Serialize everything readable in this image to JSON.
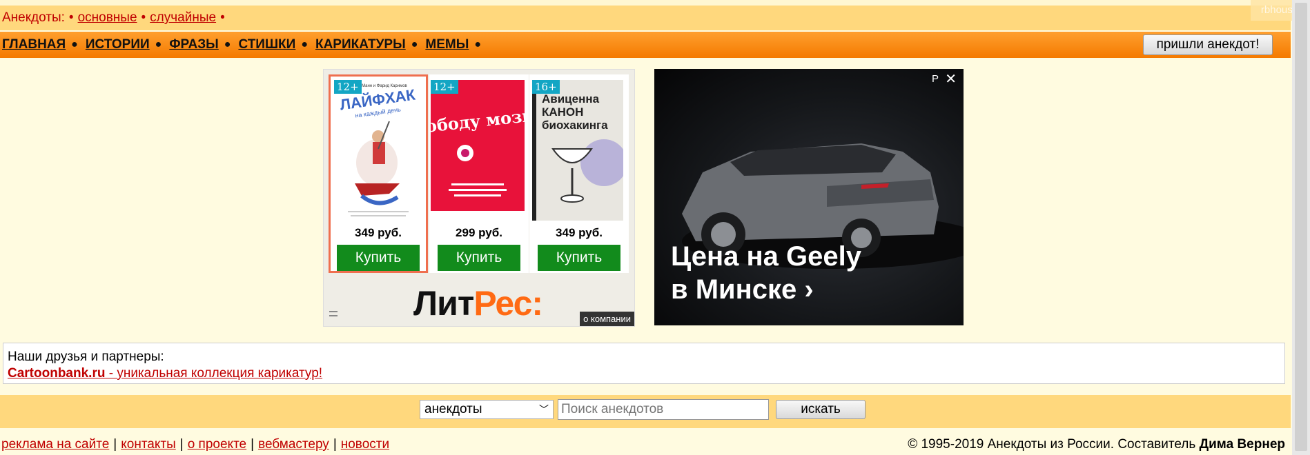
{
  "top_bar": {
    "label": "Анекдоты:",
    "links": [
      "основные",
      "случайные"
    ],
    "corner": "rbhouse"
  },
  "nav": {
    "items": [
      "ГЛАВНАЯ",
      "ИСТОРИИ",
      "ФРАЗЫ",
      "СТИШКИ",
      "КАРИКАТУРЫ",
      "МЕМЫ"
    ],
    "send_button": "пришли анекдот!"
  },
  "litres_ad": {
    "books": [
      {
        "age": "12+",
        "cover_author": "Игорь Манн и Фарид Каримов",
        "cover_title": "ЛАЙФХАК",
        "cover_sub": "на каждый день",
        "price": "349 руб.",
        "buy": "Купить",
        "cover_color": "#ffffff"
      },
      {
        "age": "12+",
        "cover_title": "свободу мозгу!",
        "price": "299 руб.",
        "buy": "Купить",
        "cover_color": "#e8123a"
      },
      {
        "age": "16+",
        "cover_title": "Авиценна КАНОН биохакинга",
        "price": "349 руб.",
        "buy": "Купить",
        "cover_color": "#c6c5d6"
      }
    ],
    "logo_part1": "Лит",
    "logo_part2": "Рес:",
    "about": "о компании"
  },
  "car_ad": {
    "line1": "Цена на Geely",
    "line2": "в Минске ›",
    "ad_mark": "Р",
    "close": "✕"
  },
  "partners": {
    "title": "Наши друзья и партнеры:",
    "link_strong": "Cartoonbank.ru",
    "link_rest": " - уникальная коллекция карикатур!"
  },
  "search": {
    "select_value": "анекдоты",
    "placeholder": "Поиск анекдотов",
    "button": "искать"
  },
  "footer": {
    "links": [
      "реклама на сайте",
      "контакты",
      "о проекте",
      "вебмастеру",
      "новости"
    ],
    "copyright": "© 1995-2019 Анекдоты из России. Составитель",
    "author": "Дима Вернер"
  }
}
